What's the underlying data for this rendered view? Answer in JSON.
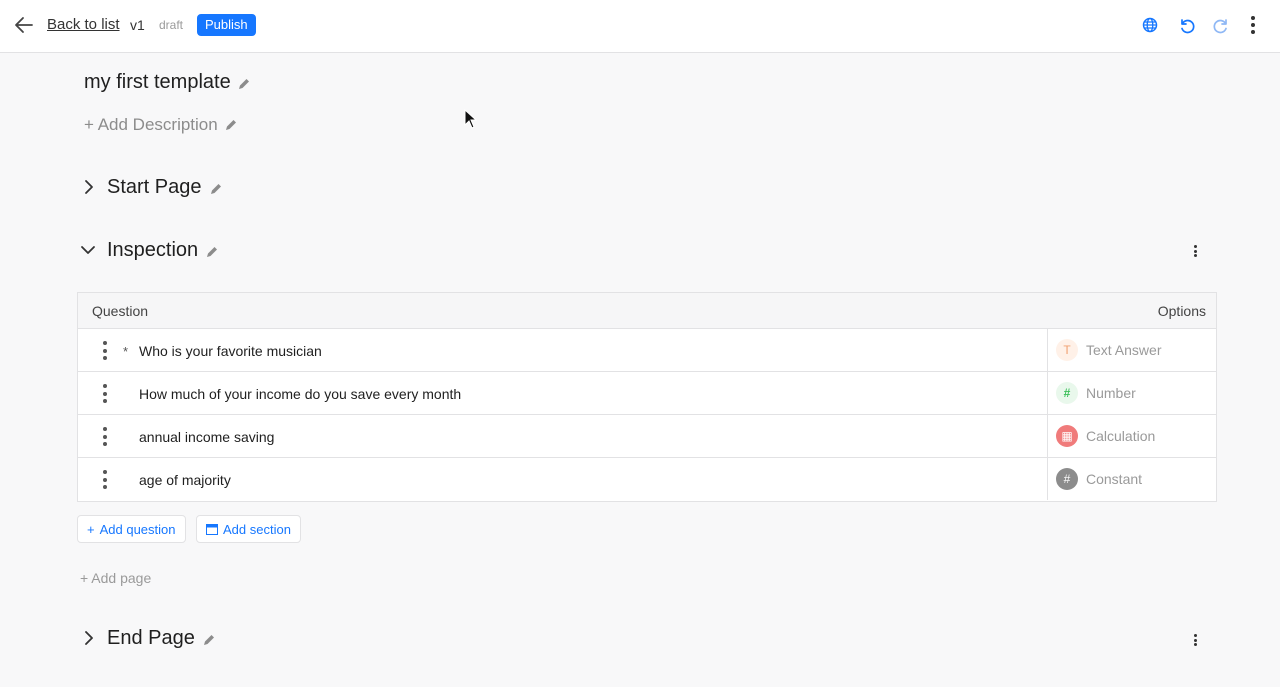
{
  "topbar": {
    "back_label": "Back to list",
    "version": "v1",
    "status": "draft",
    "publish_label": "Publish",
    "icons": [
      "globe-icon",
      "undo-icon",
      "redo-icon",
      "more-vertical-icon"
    ]
  },
  "template": {
    "title": "my first template",
    "add_description": "+ Add Description"
  },
  "pages": [
    {
      "title": "Start Page",
      "expanded": false
    },
    {
      "title": "Inspection",
      "expanded": true
    },
    {
      "title": "End Page",
      "expanded": false
    }
  ],
  "table": {
    "headers": {
      "question": "Question",
      "options": "Options"
    },
    "rows": [
      {
        "required": true,
        "required_mark": "*",
        "question": "Who is your favorite musician",
        "type": "Text Answer",
        "type_icon": "text-type-icon",
        "badge_glyph": "T",
        "badge_bg": "#fff1e8",
        "badge_color": "#f0a070"
      },
      {
        "required": false,
        "required_mark": "",
        "question": "How much of your income do you save every month",
        "type": "Number",
        "type_icon": "number-type-icon",
        "badge_glyph": "#",
        "badge_bg": "#e9f8ec",
        "badge_color": "#3cbf5a"
      },
      {
        "required": false,
        "required_mark": "",
        "question": "annual income saving",
        "type": "Calculation",
        "type_icon": "calculator-type-icon",
        "badge_glyph": "▦",
        "badge_bg": "#f07b7b",
        "badge_color": "#ffffff"
      },
      {
        "required": false,
        "required_mark": "",
        "question": "age of majority",
        "type": "Constant",
        "type_icon": "constant-type-icon",
        "badge_glyph": "#",
        "badge_bg": "#8c8c8c",
        "badge_color": "#ffffff"
      }
    ]
  },
  "actions": {
    "add_question": "Add question",
    "add_section": "Add section",
    "add_page": "+ Add page"
  },
  "colors": {
    "accent": "#1677ff",
    "background": "#f8f8f9"
  }
}
